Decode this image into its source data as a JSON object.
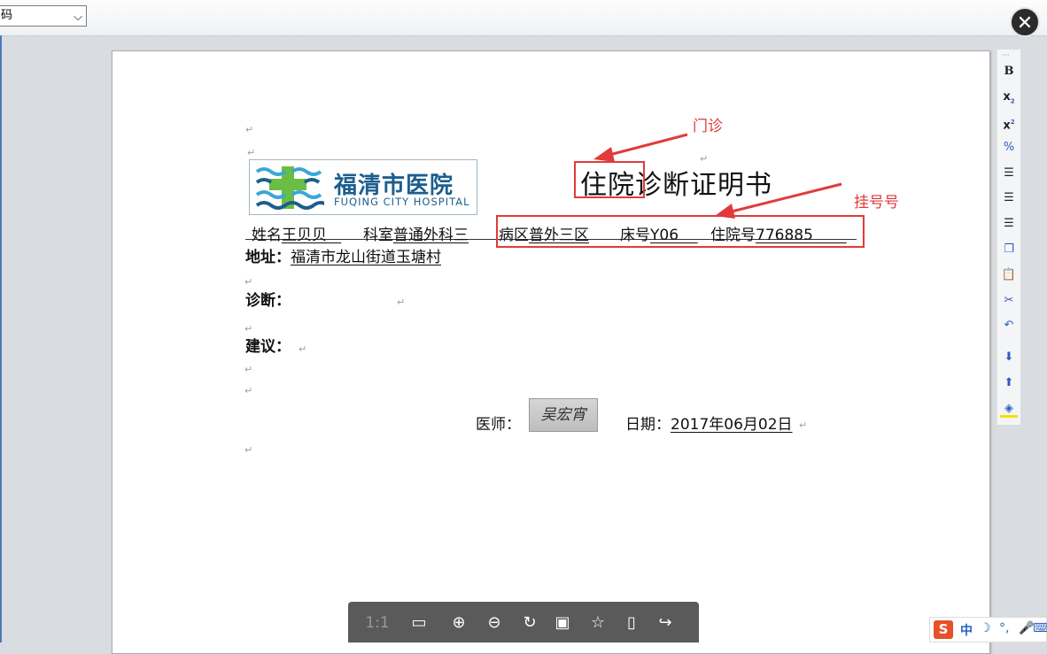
{
  "header": {
    "select_value": "码",
    "close_label": "✕"
  },
  "document": {
    "logo_chinese": "福清市医院",
    "logo_english": "FUQING CITY HOSPITAL",
    "title": "住院诊断证明书",
    "name_label": "姓名",
    "name_value": "王贝贝",
    "dept_label": "科室",
    "dept_value": "普通外科三",
    "ward_label": "病区",
    "ward_value": "普外三区",
    "bed_label": "床号",
    "bed_value": "Y06",
    "inpatient_no_label": "住院号",
    "inpatient_no_value": "776885",
    "address_label": "地址：",
    "address_value": "福清市龙山街道玉塘村",
    "diagnosis_label": "诊断：",
    "advice_label": "建议：",
    "doctor_label": "医师：",
    "signature_text": "吴宏宵",
    "date_label": "日期：",
    "date_value": "2017年06月02日"
  },
  "annotations": {
    "note_1": "门诊",
    "note_2": "挂号号"
  },
  "side_toolbar": [
    "bold-icon",
    "subscript-icon",
    "superscript-icon",
    "percent-icon",
    "align-left-icon",
    "align-center-icon",
    "align-right-icon",
    "copy-icon",
    "paste-icon",
    "cut-icon",
    "undo-icon",
    "move-down-icon",
    "move-up-icon",
    "fill-color-icon"
  ],
  "viewer_toolbar": {
    "actual_size_label": "1:1"
  },
  "ime": {
    "logo": "S",
    "mode": "中"
  },
  "colors": {
    "annotation_red": "#e23a3a",
    "logo_blue": "#1c5e8e"
  }
}
